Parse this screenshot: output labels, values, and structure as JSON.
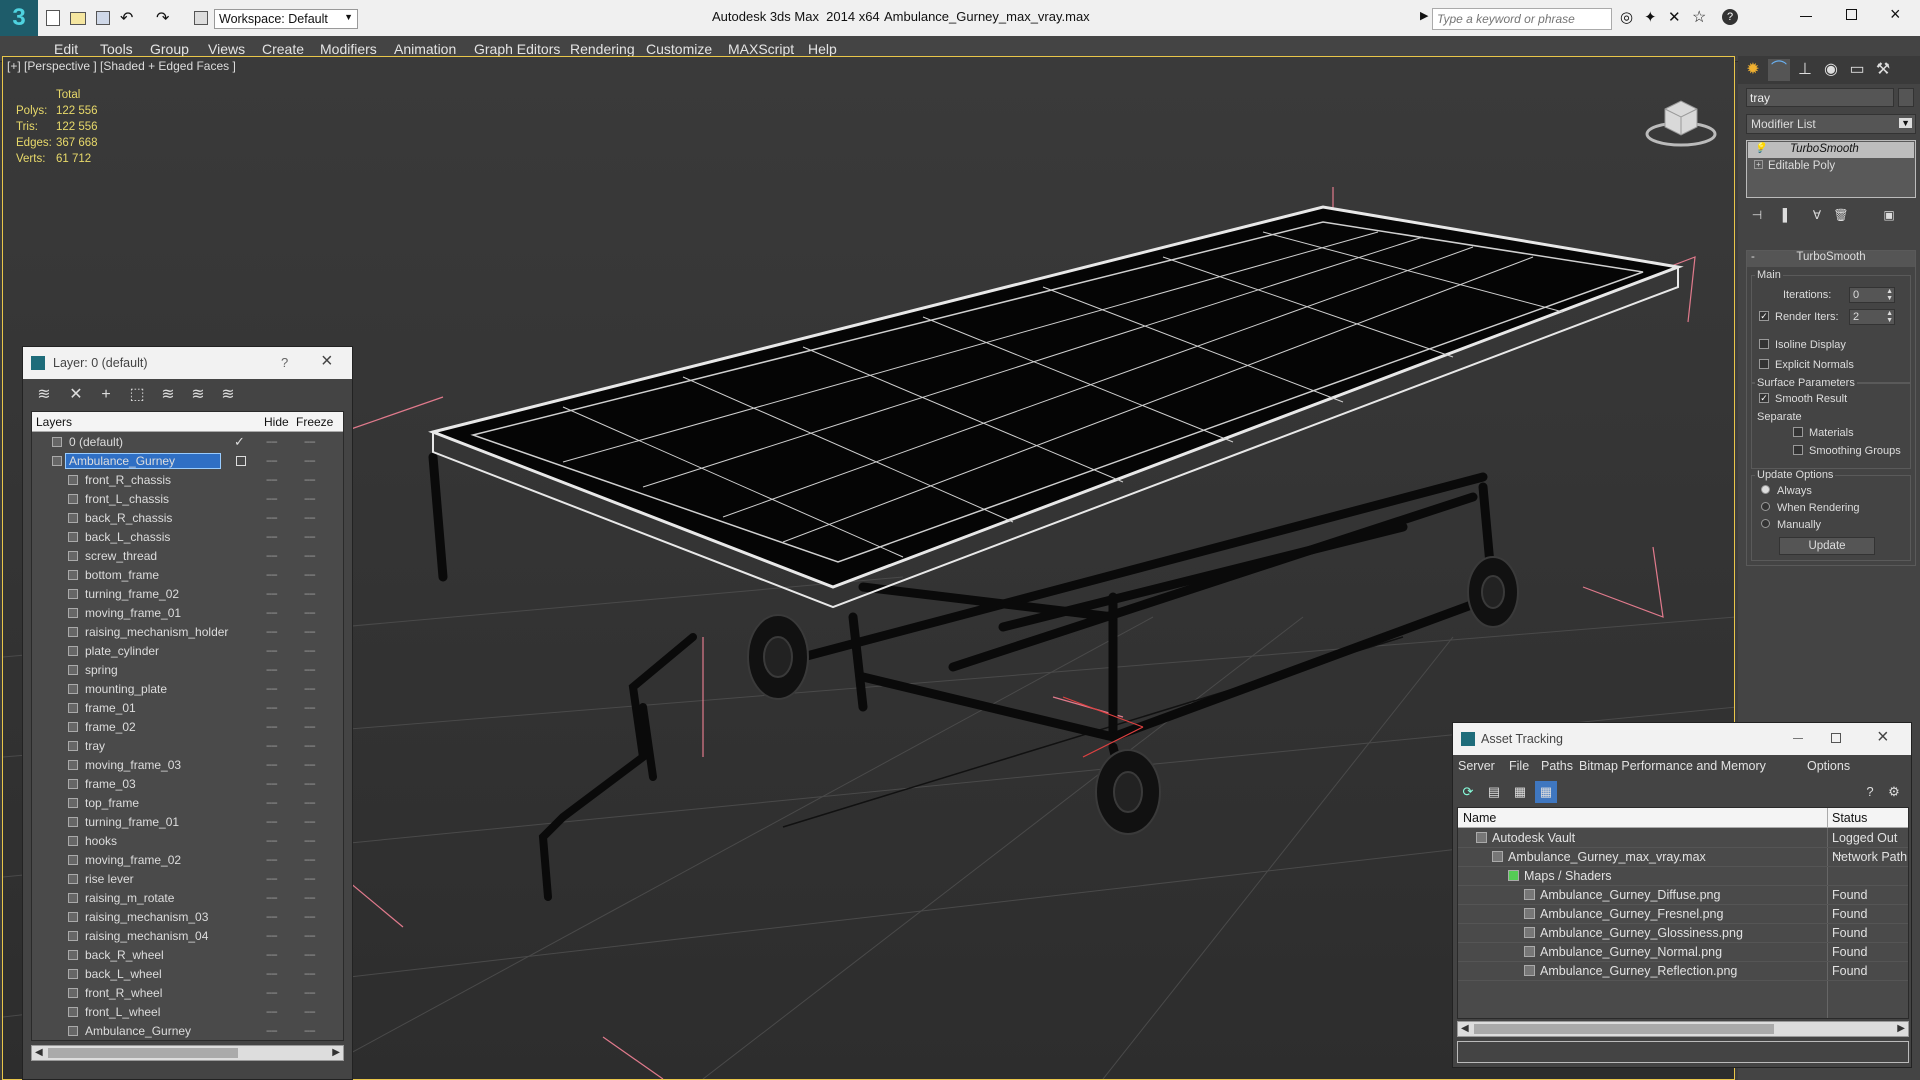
{
  "titlebar": {
    "workspace": "Workspace: Default",
    "app_title": "Autodesk 3ds Max  2014 x64",
    "file_title": "Ambulance_Gurney_max_vray.max",
    "search_placeholder": "Type a keyword or phrase",
    "help_icon": "?"
  },
  "menu": [
    "Edit",
    "Tools",
    "Group",
    "Views",
    "Create",
    "Modifiers",
    "Animation",
    "Graph Editors",
    "Rendering",
    "Customize",
    "MAXScript",
    "Help"
  ],
  "viewport": {
    "label": "[+] [Perspective ] [Shaded + Edged Faces ]",
    "stats": {
      "total_label": "Total",
      "rows": [
        {
          "label": "Polys:",
          "value": "122 556"
        },
        {
          "label": "Tris:",
          "value": "122 556"
        },
        {
          "label": "Edges:",
          "value": "367 668"
        },
        {
          "label": "Verts:",
          "value": "61 712"
        }
      ]
    }
  },
  "layer_window": {
    "title": "Layer: 0 (default)",
    "help": "?",
    "col_layers": "Layers",
    "col_hide": "Hide",
    "col_freeze": "Freeze",
    "dash": "----",
    "layers": [
      {
        "name": "0 (default)",
        "level": 0
      },
      {
        "name": "Ambulance_Gurney",
        "level": 0,
        "selected": true
      }
    ],
    "objects": [
      "front_R_chassis",
      "front_L_chassis",
      "back_R_chassis",
      "back_L_chassis",
      "screw_thread",
      "bottom_frame",
      "turning_frame_02",
      "moving_frame_01",
      "raising_mechanism_holder",
      "plate_cylinder",
      "spring",
      "mounting_plate",
      "frame_01",
      "frame_02",
      "tray",
      "moving_frame_03",
      "frame_03",
      "top_frame",
      "turning_frame_01",
      "hooks",
      "moving_frame_02",
      "rise lever",
      "raising_m_rotate",
      "raising_mechanism_03",
      "raising_mechanism_04",
      "back_R_wheel",
      "back_L_wheel",
      "front_R_wheel",
      "front_L_wheel",
      "Ambulance_Gurney"
    ]
  },
  "command_panel": {
    "object_name": "tray",
    "modifier_list": "Modifier List",
    "stack": [
      "TurboSmooth",
      "Editable Poly"
    ],
    "rollout_title": "TurboSmooth",
    "main_label": "Main",
    "iterations_label": "Iterations:",
    "iterations_value": "0",
    "render_iters_label": "Render Iters:",
    "render_iters_value": "2",
    "isoline_label": "Isoline Display",
    "explicit_normals_label": "Explicit Normals",
    "surface_params_label": "Surface Parameters",
    "smooth_result_label": "Smooth Result",
    "separate_label": "Separate",
    "materials_label": "Materials",
    "smoothing_groups_label": "Smoothing Groups",
    "update_options_label": "Update Options",
    "always_label": "Always",
    "when_rendering_label": "When Rendering",
    "manually_label": "Manually",
    "update_button": "Update"
  },
  "asset_window": {
    "title": "Asset Tracking",
    "menu": [
      "Server",
      "File",
      "Paths",
      "Bitmap Performance and Memory",
      "Options"
    ],
    "col_name": "Name",
    "col_status": "Status",
    "rows": [
      {
        "name": "Autodesk Vault",
        "status": "Logged Out ...",
        "indent": 0
      },
      {
        "name": "Ambulance_Gurney_max_vray.max",
        "status": "Network Path",
        "indent": 1
      },
      {
        "name": "Maps / Shaders",
        "status": "",
        "indent": 2
      },
      {
        "name": "Ambulance_Gurney_Diffuse.png",
        "status": "Found",
        "indent": 3
      },
      {
        "name": "Ambulance_Gurney_Fresnel.png",
        "status": "Found",
        "indent": 3
      },
      {
        "name": "Ambulance_Gurney_Glossiness.png",
        "status": "Found",
        "indent": 3
      },
      {
        "name": "Ambulance_Gurney_Normal.png",
        "status": "Found",
        "indent": 3
      },
      {
        "name": "Ambulance_Gurney_Reflection.png",
        "status": "Found",
        "indent": 3
      }
    ]
  },
  "colors": {
    "accent": "#e9c64a",
    "selection": "#2f6fc4",
    "viewport_bg": "#333333",
    "stat_text": "#e8d96a"
  }
}
